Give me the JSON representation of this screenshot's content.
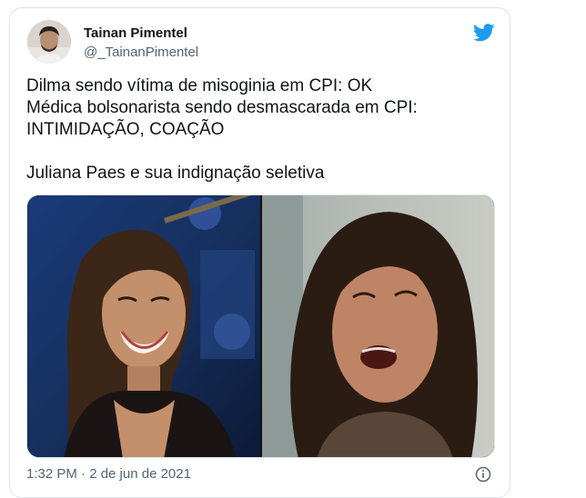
{
  "author": {
    "name": "Tainan Pimentel",
    "handle": "@_TainanPimentel"
  },
  "tweet": {
    "lines": [
      "Dilma sendo vítima de misoginia em CPI: OK",
      "Médica bolsonarista sendo desmascarada em CPI:",
      "INTIMIDAÇÃO, COAÇÃO",
      "",
      "Juliana Paes e sua indignação seletiva"
    ],
    "timestamp": "1:32 PM · 2 de jun de 2021"
  },
  "media": {
    "images": [
      "smiling-woman-photo",
      "crying-woman-photo"
    ]
  },
  "icons": {
    "brand": "twitter-bird-icon",
    "info": "info-icon"
  },
  "colors": {
    "brand_blue": "#1d9bf0",
    "text_primary": "#0f1419",
    "text_secondary": "#536471",
    "border": "#dfe3e6"
  }
}
